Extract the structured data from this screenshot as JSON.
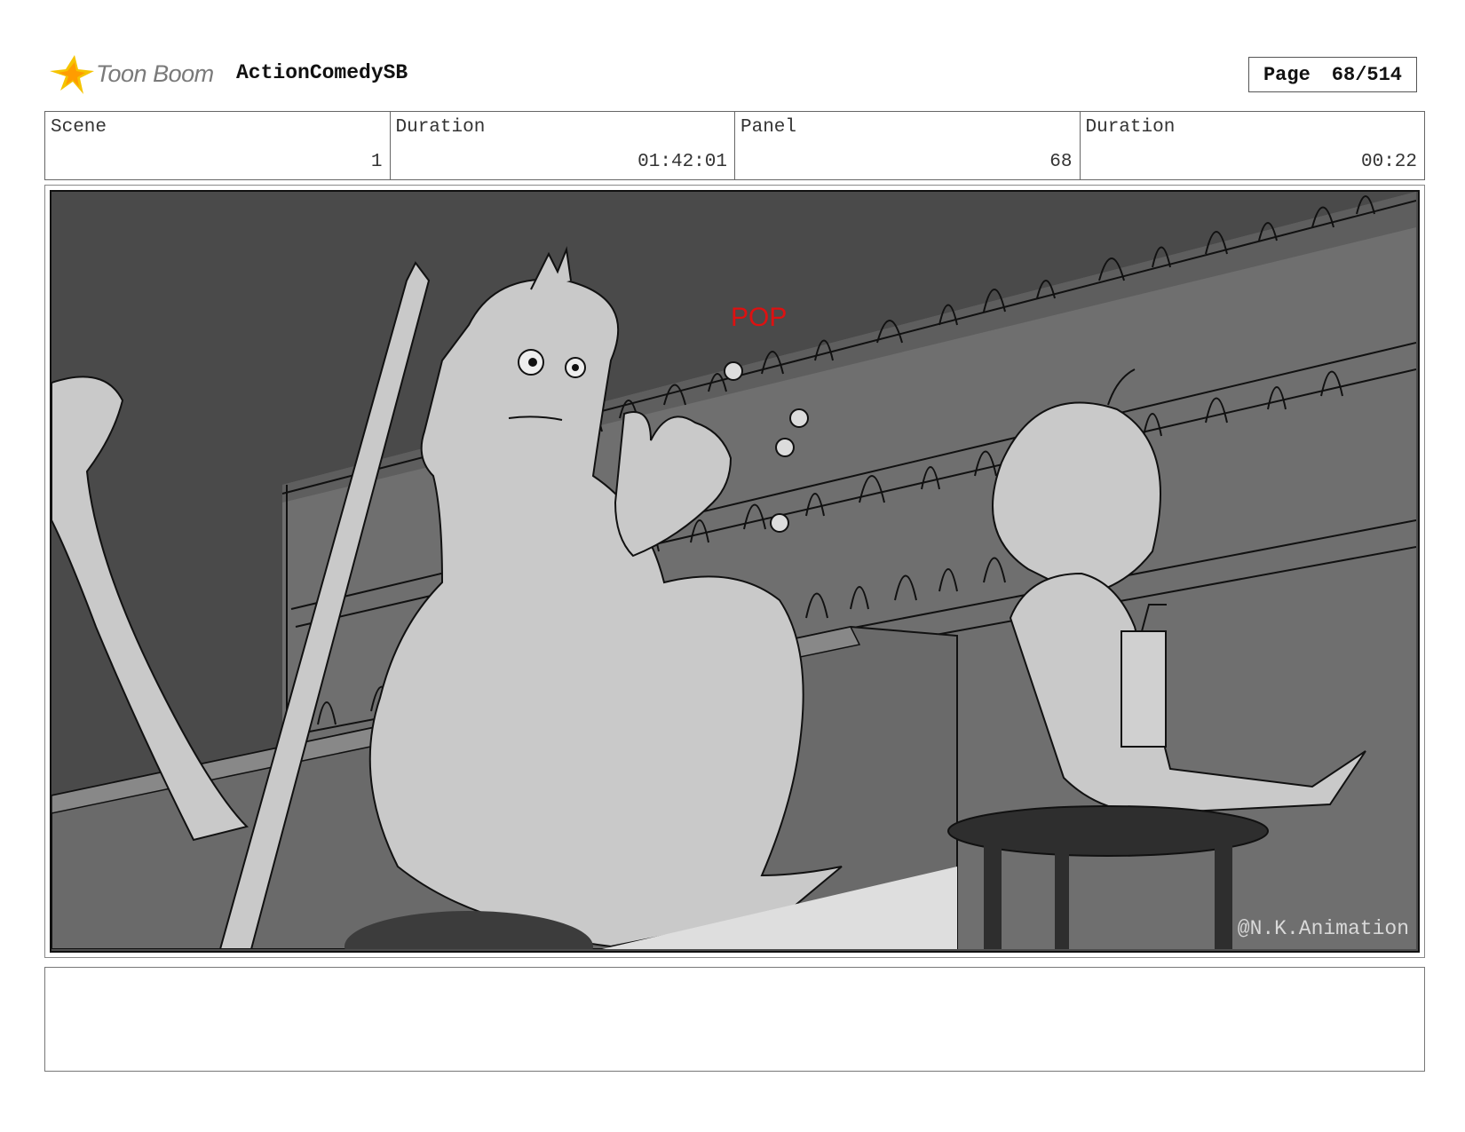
{
  "header": {
    "logo_text": "Toon Boom",
    "project_title": "ActionComedySB",
    "page_label": "Page",
    "page_value": "68/514"
  },
  "info": {
    "scene_label": "Scene",
    "scene_value": "1",
    "scene_duration_label": "Duration",
    "scene_duration_value": "01:42:01",
    "panel_label": "Panel",
    "panel_value": "68",
    "panel_duration_label": "Duration",
    "panel_duration_value": "00:22"
  },
  "panel": {
    "watermark": "@N.K.Animation",
    "sfx_pop": "POP"
  },
  "notes": {
    "text": ""
  }
}
